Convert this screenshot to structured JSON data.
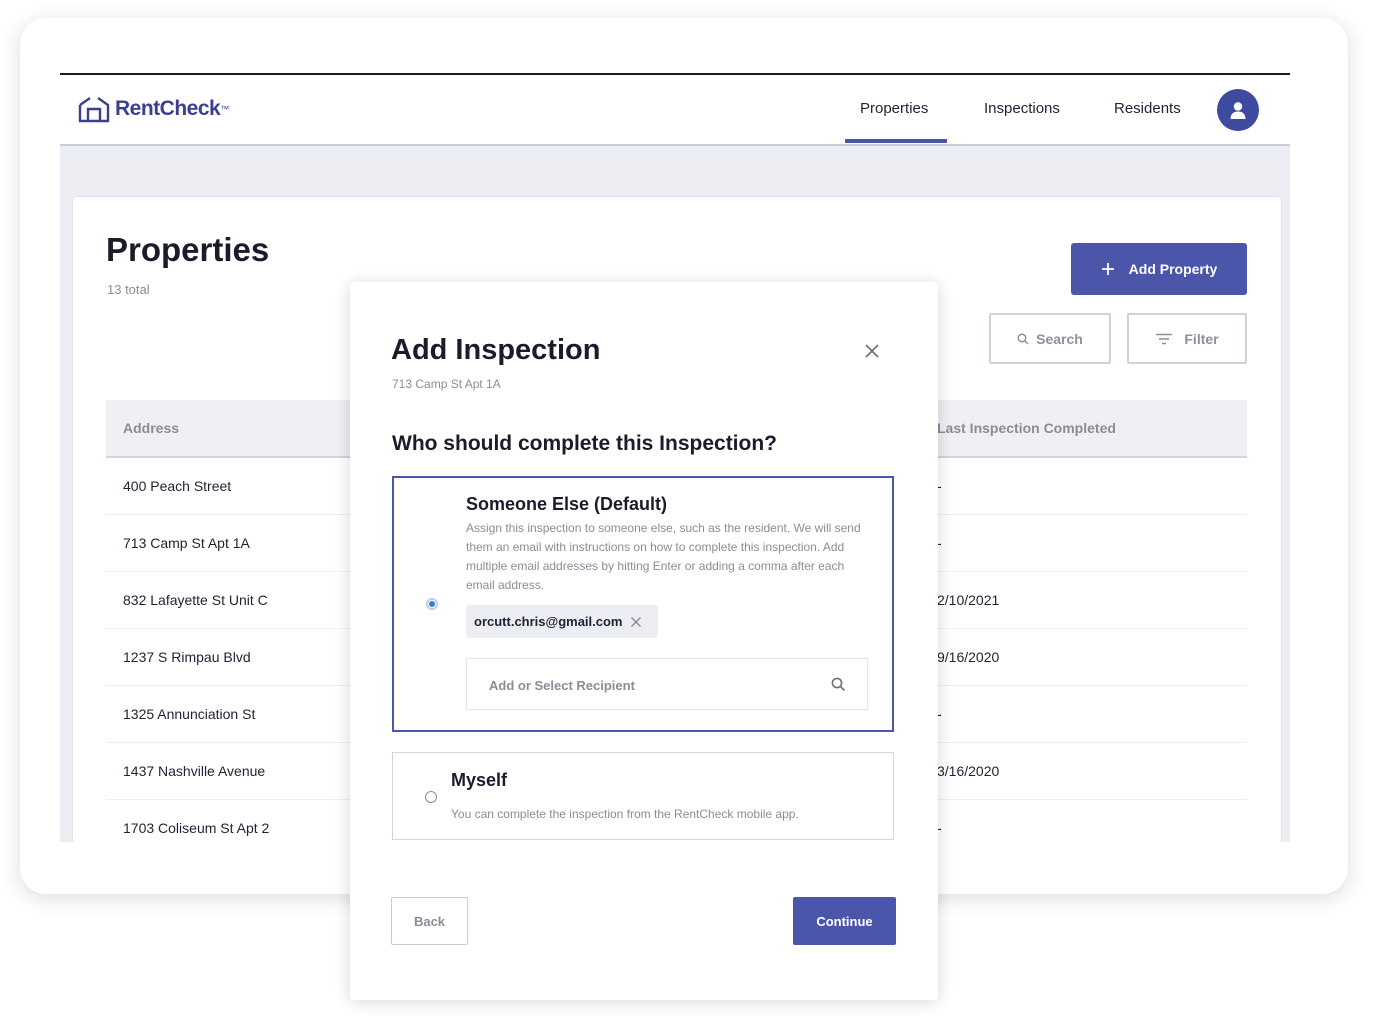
{
  "brand": {
    "name": "RentCheck",
    "tm": "™"
  },
  "nav": {
    "items": [
      {
        "label": "Properties",
        "active": true
      },
      {
        "label": "Inspections",
        "active": false
      },
      {
        "label": "Residents",
        "active": false
      }
    ]
  },
  "colors": {
    "accent": "#4b56ab",
    "radio": "#3b7bd6"
  },
  "page": {
    "title": "Properties",
    "subtitle": "13 total",
    "add_button": "Add Property",
    "search_button": "Search",
    "filter_button": "Filter"
  },
  "table": {
    "headers": {
      "address": "Address",
      "last_completed": "Last Inspection Completed"
    },
    "rows": [
      {
        "address": "400 Peach Street",
        "date": "-"
      },
      {
        "address": "713 Camp St Apt 1A",
        "date": "-"
      },
      {
        "address": "832 Lafayette St Unit C",
        "date": "2/10/2021"
      },
      {
        "address": "1237 S Rimpau Blvd",
        "date": "9/16/2020"
      },
      {
        "address": "1325 Annunciation St",
        "date": "-"
      },
      {
        "address": "1437 Nashville Avenue",
        "date": "3/16/2020"
      },
      {
        "address": "1703 Coliseum St Apt 2",
        "date": "-"
      }
    ]
  },
  "modal": {
    "title": "Add Inspection",
    "subtitle": "713 Camp St Apt 1A",
    "question": "Who should complete this Inspection?",
    "option_someone": {
      "title": "Someone Else (Default)",
      "description": "Assign this inspection to someone else, such as the resident. We will send them an email with instructions on how to complete this inspection. Add multiple email addresses by hitting Enter or adding a comma after each email address.",
      "selected": true
    },
    "chip_email": "orcutt.chris@gmail.com",
    "recipient_placeholder": "Add or Select Recipient",
    "option_myself": {
      "title": "Myself",
      "description": "You can complete the inspection from the RentCheck mobile app.",
      "selected": false
    },
    "back_button": "Back",
    "continue_button": "Continue"
  }
}
